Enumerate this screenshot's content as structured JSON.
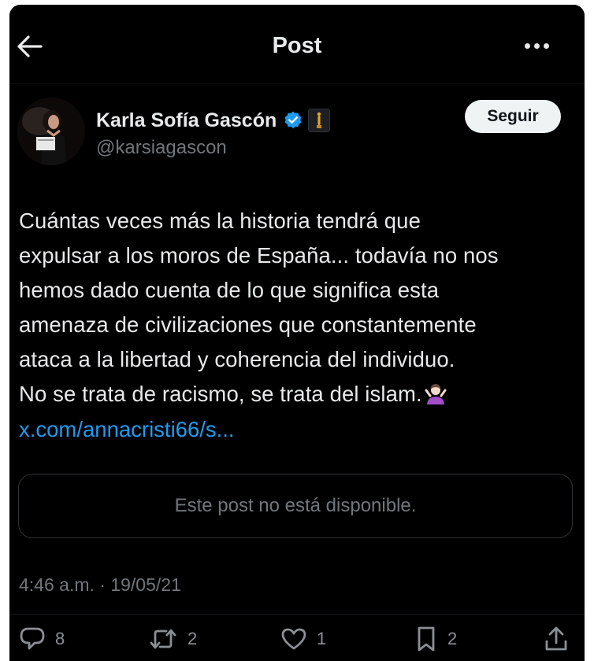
{
  "header": {
    "title": "Post"
  },
  "author": {
    "name": "Karla Sofía Gascón",
    "handle": "@karsiagascon",
    "follow_label": "Seguir"
  },
  "post": {
    "lines": [
      "Cuántas veces más la historia tendrá que",
      "expulsar a los moros de España... todavía no nos",
      "hemos dado cuenta de lo que significa esta",
      "amenaza de civilizaciones que constantemente",
      "ataca a la libertad y coherencia del individuo.",
      "No se trata de racismo, se trata del islam."
    ],
    "link": "x.com/annacristi66/s...",
    "quote_unavailable": "Este post no está disponible.",
    "timestamp": "4:46 a.m. · 19/05/21"
  },
  "actions": {
    "replies": "8",
    "reposts": "2",
    "likes": "1",
    "bookmarks": "2"
  },
  "icons": {
    "back": "arrow-left-icon",
    "more": "more-horizontal-icon",
    "verified": "verified-badge-icon",
    "badge": "oscar-statuette-icon",
    "shrug": "person-shrugging-emoji",
    "reply": "reply-icon",
    "repost": "repost-icon",
    "like": "heart-icon",
    "bookmark": "bookmark-icon",
    "share": "share-icon"
  },
  "colors": {
    "background": "#000000",
    "text": "#e7e9ea",
    "secondary": "#71767b",
    "link": "#1d9bf0",
    "verified": "#1d9bf0",
    "follow_bg": "#eff3f4"
  }
}
